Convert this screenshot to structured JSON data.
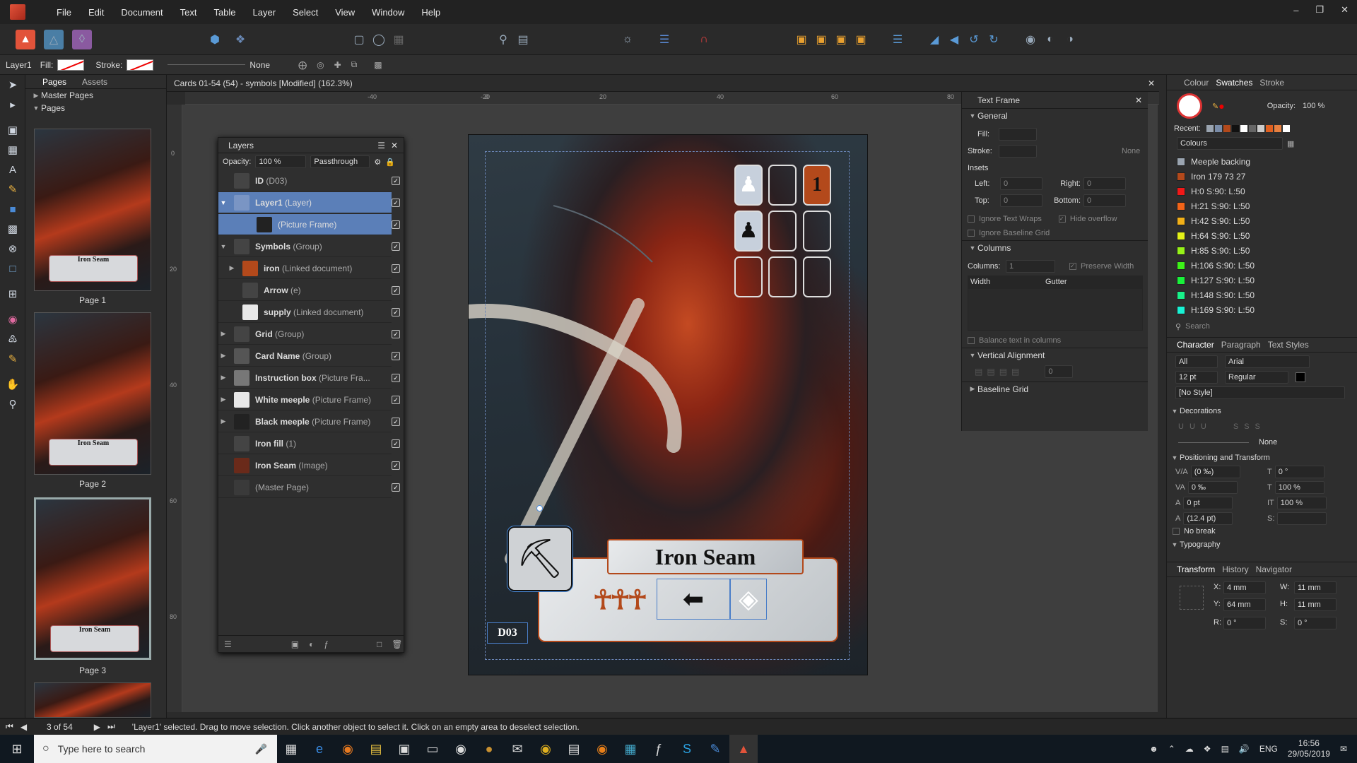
{
  "menu": {
    "items": [
      "File",
      "Edit",
      "Document",
      "Text",
      "Table",
      "Layer",
      "Select",
      "View",
      "Window",
      "Help"
    ]
  },
  "context": {
    "layer": "Layer1",
    "fill_label": "Fill:",
    "stroke_label": "Stroke:",
    "stroke_none": "None"
  },
  "pages_panel": {
    "tabs": [
      "Pages",
      "Assets"
    ],
    "master_pages": "Master Pages",
    "pages": "Pages",
    "page_labels": [
      "Page 1",
      "Page 2",
      "Page 3"
    ],
    "card_name": "Iron Seam"
  },
  "document": {
    "title": "Cards 01-54 (54) - symbols [Modified] (162.3%)",
    "ruler_ticks": [
      "-40",
      "-20",
      "0",
      "20",
      "40",
      "60",
      "80"
    ],
    "vruler_ticks": [
      "0",
      "20",
      "40",
      "60",
      "80"
    ]
  },
  "card": {
    "name": "Iron Seam",
    "id": "D03",
    "number": "1"
  },
  "layers_panel": {
    "title": "Layers",
    "opacity_label": "Opacity:",
    "opacity": "100 %",
    "blend": "Passthrough",
    "rows": [
      {
        "name": "ID",
        "type": "(D03)"
      },
      {
        "name": "Layer1",
        "type": "(Layer)"
      },
      {
        "name": "",
        "type": "(Picture Frame)"
      },
      {
        "name": "Symbols",
        "type": "(Group)"
      },
      {
        "name": "iron",
        "type": "(Linked document)"
      },
      {
        "name": "Arrow",
        "type": "(e)"
      },
      {
        "name": "supply",
        "type": "(Linked document)"
      },
      {
        "name": "Grid",
        "type": "(Group)"
      },
      {
        "name": "Card Name",
        "type": "(Group)"
      },
      {
        "name": "Instruction box",
        "type": "(Picture Fra..."
      },
      {
        "name": "White meeple",
        "type": "(Picture Frame)"
      },
      {
        "name": "Black meeple",
        "type": "(Picture Frame)"
      },
      {
        "name": "Iron fill",
        "type": "(1)"
      },
      {
        "name": "Iron Seam",
        "type": "(Image)"
      },
      {
        "name": "",
        "type": "(Master Page)"
      }
    ]
  },
  "textframe_panel": {
    "title": "Text Frame",
    "general": "General",
    "fill": "Fill:",
    "stroke": "Stroke:",
    "none": "None",
    "insets": "Insets",
    "left": "Left:",
    "right": "Right:",
    "top": "Top:",
    "bottom": "Bottom:",
    "zero": "0",
    "ignore_wraps": "Ignore Text Wraps",
    "hide_overflow": "Hide overflow",
    "ignore_baseline": "Ignore Baseline Grid",
    "columns_section": "Columns",
    "columns_label": "Columns:",
    "columns_value": "1",
    "preserve_width": "Preserve Width",
    "width": "Width",
    "gutter": "Gutter",
    "balance": "Balance text in columns",
    "vertical_alignment": "Vertical Alignment",
    "baseline_grid": "Baseline Grid"
  },
  "right_panel": {
    "tabs": [
      "Colour",
      "Swatches",
      "Stroke"
    ],
    "opacity_label": "Opacity:",
    "opacity": "100 %",
    "recent": "Recent:",
    "palette": "Colours",
    "search": "Search",
    "swatches": [
      {
        "name": "Meeple backing",
        "color": "#9aa4b0"
      },
      {
        "name": "Iron 179 73 27",
        "color": "#b3491b"
      },
      {
        "name": "H:0 S:90: L:50",
        "color": "#f21818"
      },
      {
        "name": "H:21 S:90: L:50",
        "color": "#f26418"
      },
      {
        "name": "H:42 S:90: L:50",
        "color": "#f2b018"
      },
      {
        "name": "H:64 S:90: L:50",
        "color": "#e4f218"
      },
      {
        "name": "H:85 S:90: L:50",
        "color": "#96f218"
      },
      {
        "name": "H:106 S:90: L:50",
        "color": "#3df218"
      },
      {
        "name": "H:127 S:90: L:50",
        "color": "#18f23a"
      },
      {
        "name": "H:148 S:90: L:50",
        "color": "#18f28a"
      },
      {
        "name": "H:169 S:90: L:50",
        "color": "#18f2d4"
      }
    ],
    "char_tabs": [
      "Character",
      "Paragraph",
      "Text Styles"
    ],
    "all": "All",
    "font": "Arial",
    "size": "12 pt",
    "style": "Regular",
    "no_style": "[No Style]",
    "decorations": "Decorations",
    "none": "None",
    "positioning": "Positioning and Transform",
    "pos_values": [
      "(0 ‰)",
      "0 ‰",
      "0 pt",
      "(12.4 pt)",
      "0 °",
      "100 %",
      "100 %"
    ],
    "s_label": "S:",
    "no_break": "No break",
    "typography": "Typography",
    "transform_tabs": [
      "Transform",
      "History",
      "Navigator"
    ],
    "x_label": "X:",
    "x": "4 mm",
    "y_label": "Y:",
    "y": "64 mm",
    "w_label": "W:",
    "w": "11 mm",
    "h_label": "H:",
    "h": "11 mm",
    "r_label": "R:",
    "r": "0 °",
    "s2_label": "S:",
    "s": "0 °"
  },
  "status": {
    "page": "3 of 54",
    "message": "'Layer1' selected. Drag to move selection. Click another object to select it. Click on an empty area to deselect selection."
  },
  "taskbar": {
    "search": "Type here to search",
    "lang": "ENG",
    "time": "16:56",
    "date": "29/05/2019"
  }
}
